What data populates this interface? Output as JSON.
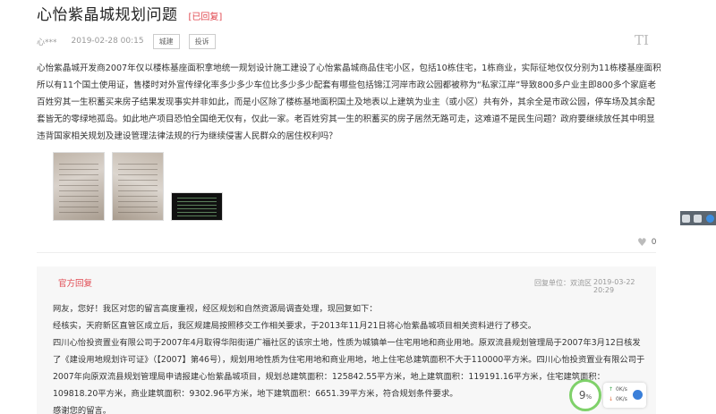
{
  "post": {
    "title": "心怡紫晶城规划问题",
    "status": "[已回复]",
    "user": "心***",
    "date": "2019-02-28 00:15",
    "tags": [
      "城建",
      "投诉"
    ],
    "font_toggle": "TI",
    "body": "心怡紫晶城开发商2007年仅以楼栋基座面积拿地统一规划设计施工建设了心怡紫晶城商品住宅小区，包括10栋住宅，1栋商业，实际征地仅仅分别为11栋楼基座面积所以有11个国土使用证，售楼时对外宣传绿化率多少多少车位比多少多少配套有哪些包括锦江河岸市政公园都被称为“私家江岸”导致800多户业主即800多个家庭老百姓穷其一生积蓄买来房子结果发现事实并非如此，而是小区除了楼栋基地面积国土及地表以上建筑为业主（或小区）共有外，其余全是市政公园，停车场及其余配套皆无的零绿地孤岛。如此地产项目恐怕全国绝无仅有，仅此一家。老百姓穷其一生的积蓄买的房子居然无路可走，这难道不是民生问题？政府要继续放任其中明显违背国家相关规划及建设管理法律法规的行为继续侵害人民群众的居住权利吗？",
    "likes": "0"
  },
  "images": [
    {
      "name": "document-photo-1"
    },
    {
      "name": "document-photo-2"
    },
    {
      "name": "screen-photo-3"
    }
  ],
  "reply": {
    "label": "官方回复",
    "unit": "回复单位：双流区",
    "date": "2019-03-22 20:29",
    "lines": [
      "网友，您好！我区对您的留言高度重视，经区规划和自然资源局调查处理，现回复如下：",
      "经核实，天府新区直管区成立后，我区规建局按照移交工作相关要求，于2013年11月21日将心怡紫晶城项目相关资料进行了移交。",
      "四川心怡投资置业有限公司于2007年4月取得华阳街道广福社区的该宗土地，性质为城镇单一住宅用地和商业用地。原双流县规划管理局于2007年3月12日核发了《建设用地规划许可证》（【2007】第46号），规划用地性质为住宅用地和商业用地，地上住宅总建筑面积不大于110000平方米。四川心怡投资置业有限公司于2007年向原双流县规划管理局申请报建心怡紫晶城项目，规划总建筑面积：125842.55平方米，地上建筑面积：119191.16平方米，住宅建筑面积：109818.20平方米，商业建筑面积：9302.96平方米，地下建筑面积：6651.39平方米，符合规划条件要求。",
      "感谢您的留言。"
    ]
  },
  "speed_widget": {
    "percent": "9",
    "percent_unit": "%",
    "upload": "0K/s",
    "download": "0K/s"
  },
  "colors": {
    "accent_red": "#e0464e",
    "widget_green": "#7fd16a"
  }
}
